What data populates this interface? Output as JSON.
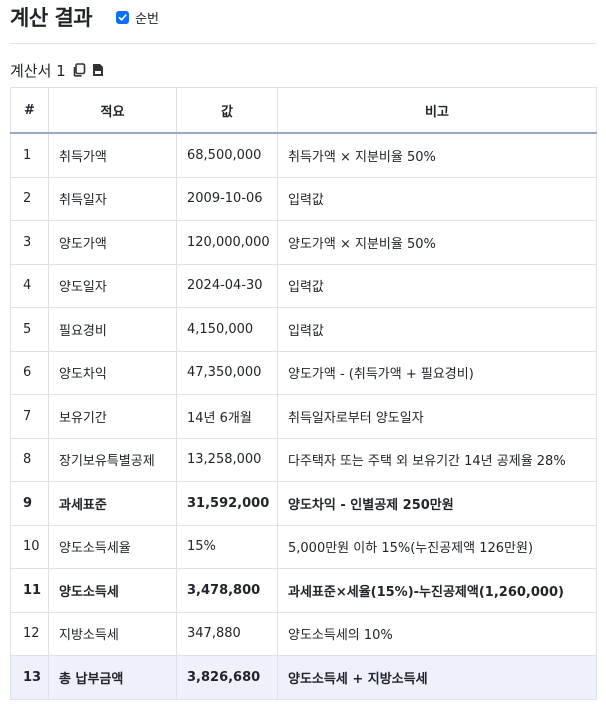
{
  "header": {
    "title": "계산 결과",
    "checkbox_label": "순번",
    "checkbox_checked": true,
    "accent": "#0d6efd"
  },
  "sheet": {
    "title": "계산서 1",
    "icons": [
      "copy-icon",
      "file-icon"
    ]
  },
  "table": {
    "columns": [
      "#",
      "적요",
      "값",
      "비고"
    ],
    "rows": [
      {
        "no": "1",
        "item": "취득가액",
        "value": "68,500,000",
        "note": "취득가액 × 지분비율 50%",
        "bold": false,
        "highlight": false
      },
      {
        "no": "2",
        "item": "취득일자",
        "value": "2009-10-06",
        "note": "입력값",
        "bold": false,
        "highlight": false
      },
      {
        "no": "3",
        "item": "양도가액",
        "value": "120,000,000",
        "note": "양도가액 × 지분비율 50%",
        "bold": false,
        "highlight": false
      },
      {
        "no": "4",
        "item": "양도일자",
        "value": "2024-04-30",
        "note": "입력값",
        "bold": false,
        "highlight": false
      },
      {
        "no": "5",
        "item": "필요경비",
        "value": "4,150,000",
        "note": "입력값",
        "bold": false,
        "highlight": false
      },
      {
        "no": "6",
        "item": "양도차익",
        "value": "47,350,000",
        "note": "양도가액 - (취득가액 + 필요경비)",
        "bold": false,
        "highlight": false
      },
      {
        "no": "7",
        "item": "보유기간",
        "value": "14년 6개월",
        "note": "취득일자로부터 양도일자",
        "bold": false,
        "highlight": false
      },
      {
        "no": "8",
        "item": "장기보유특별공제",
        "value": "13,258,000",
        "note": "다주택자 또는 주택 외 보유기간 14년 공제율 28%",
        "bold": false,
        "highlight": false
      },
      {
        "no": "9",
        "item": "과세표준",
        "value": "31,592,000",
        "note": "양도차익 - 인별공제 250만원",
        "bold": true,
        "highlight": false
      },
      {
        "no": "10",
        "item": "양도소득세율",
        "value": "15%",
        "note": "5,000만원 이하 15%(누진공제액 126만원)",
        "bold": false,
        "highlight": false
      },
      {
        "no": "11",
        "item": "양도소득세",
        "value": "3,478,800",
        "note": "과세표준×세율(15%)-누진공제액(1,260,000)",
        "bold": true,
        "highlight": false
      },
      {
        "no": "12",
        "item": "지방소득세",
        "value": "347,880",
        "note": "양도소득세의 10%",
        "bold": false,
        "highlight": false
      },
      {
        "no": "13",
        "item": "총 납부금액",
        "value": "3,826,680",
        "note": "양도소득세 + 지방소득세",
        "bold": true,
        "highlight": true
      }
    ]
  }
}
